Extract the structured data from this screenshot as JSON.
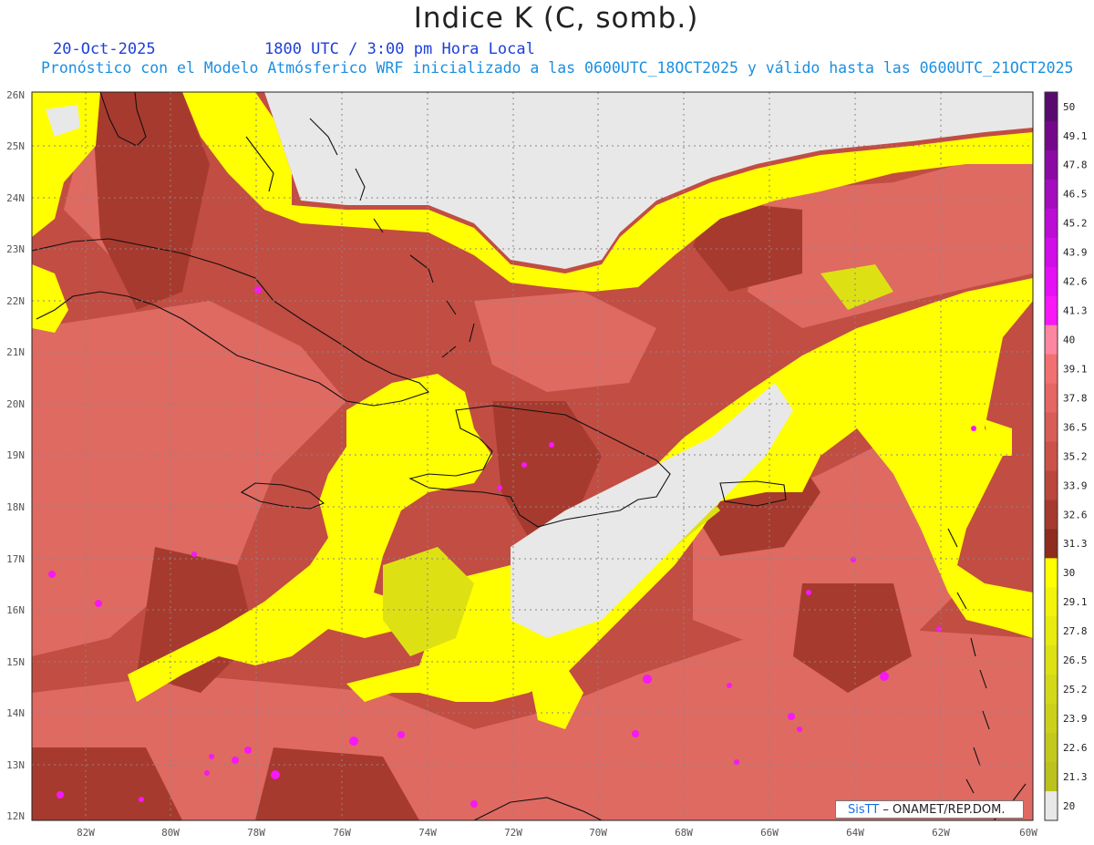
{
  "header": {
    "title": "Indice K (C, somb.)",
    "date": "20-Oct-2025",
    "time": "1800 UTC / 3:00 pm Hora Local",
    "subtitle": "Pronóstico con el Modelo Atmósferico WRF inicializado a las 0600UTC_18OCT2025 y válido hasta las  0600UTC_21OCT2025"
  },
  "map": {
    "lat_labels": [
      "26N",
      "25N",
      "24N",
      "23N",
      "22N",
      "21N",
      "20N",
      "19N",
      "18N",
      "17N",
      "16N",
      "15N",
      "14N",
      "13N",
      "12N"
    ],
    "lon_labels": [
      "82W",
      "80W",
      "78W",
      "76W",
      "74W",
      "72W",
      "70W",
      "68W",
      "66W",
      "64W",
      "62W",
      "60W"
    ],
    "lat_range": [
      12,
      26
    ],
    "lon_range": [
      -83.2,
      -60
    ],
    "grid": true,
    "gridline_style": "dotted"
  },
  "colorbar": {
    "placement": "right",
    "levels": [
      {
        "label": "50",
        "color": "#5a0a6e"
      },
      {
        "label": "49.1",
        "color": "#74088a"
      },
      {
        "label": "47.8",
        "color": "#8a0aa3"
      },
      {
        "label": "46.5",
        "color": "#a40cbd"
      },
      {
        "label": "45.2",
        "color": "#bb0dd4"
      },
      {
        "label": "43.9",
        "color": "#d10de8"
      },
      {
        "label": "42.6",
        "color": "#e40ff4"
      },
      {
        "label": "41.3",
        "color": "#f717f7"
      },
      {
        "label": "40",
        "color": "#ff86a0"
      },
      {
        "label": "39.1",
        "color": "#f27070"
      },
      {
        "label": "37.8",
        "color": "#e56662"
      },
      {
        "label": "36.5",
        "color": "#d85d56"
      },
      {
        "label": "35.2",
        "color": "#cb5249"
      },
      {
        "label": "33.9",
        "color": "#bb463c"
      },
      {
        "label": "32.6",
        "color": "#a73a2e"
      },
      {
        "label": "31.3",
        "color": "#8e2c1e"
      },
      {
        "label": "30",
        "color": "#ffff00"
      },
      {
        "label": "29.1",
        "color": "#f3f30c"
      },
      {
        "label": "27.8",
        "color": "#e8ea10"
      },
      {
        "label": "26.5",
        "color": "#dde114"
      },
      {
        "label": "25.2",
        "color": "#d3d918"
      },
      {
        "label": "23.9",
        "color": "#cbd11a"
      },
      {
        "label": "22.6",
        "color": "#c3c91c"
      },
      {
        "label": "21.3",
        "color": "#bbc21e"
      },
      {
        "label": "20",
        "color": "#e8e8e8"
      }
    ]
  },
  "field_colors": {
    "land_low": "#e8e8e8",
    "yellow": "#ffff00",
    "yellow_dim": "#d8dc18",
    "red_dark": "#a73a2e",
    "red_mid": "#c24d43",
    "red_light": "#de6a62",
    "magenta": "#f717f7",
    "coast": "#111111"
  },
  "credit": {
    "brand": "SisTT",
    "org": " – ONAMET/REP.DOM."
  }
}
